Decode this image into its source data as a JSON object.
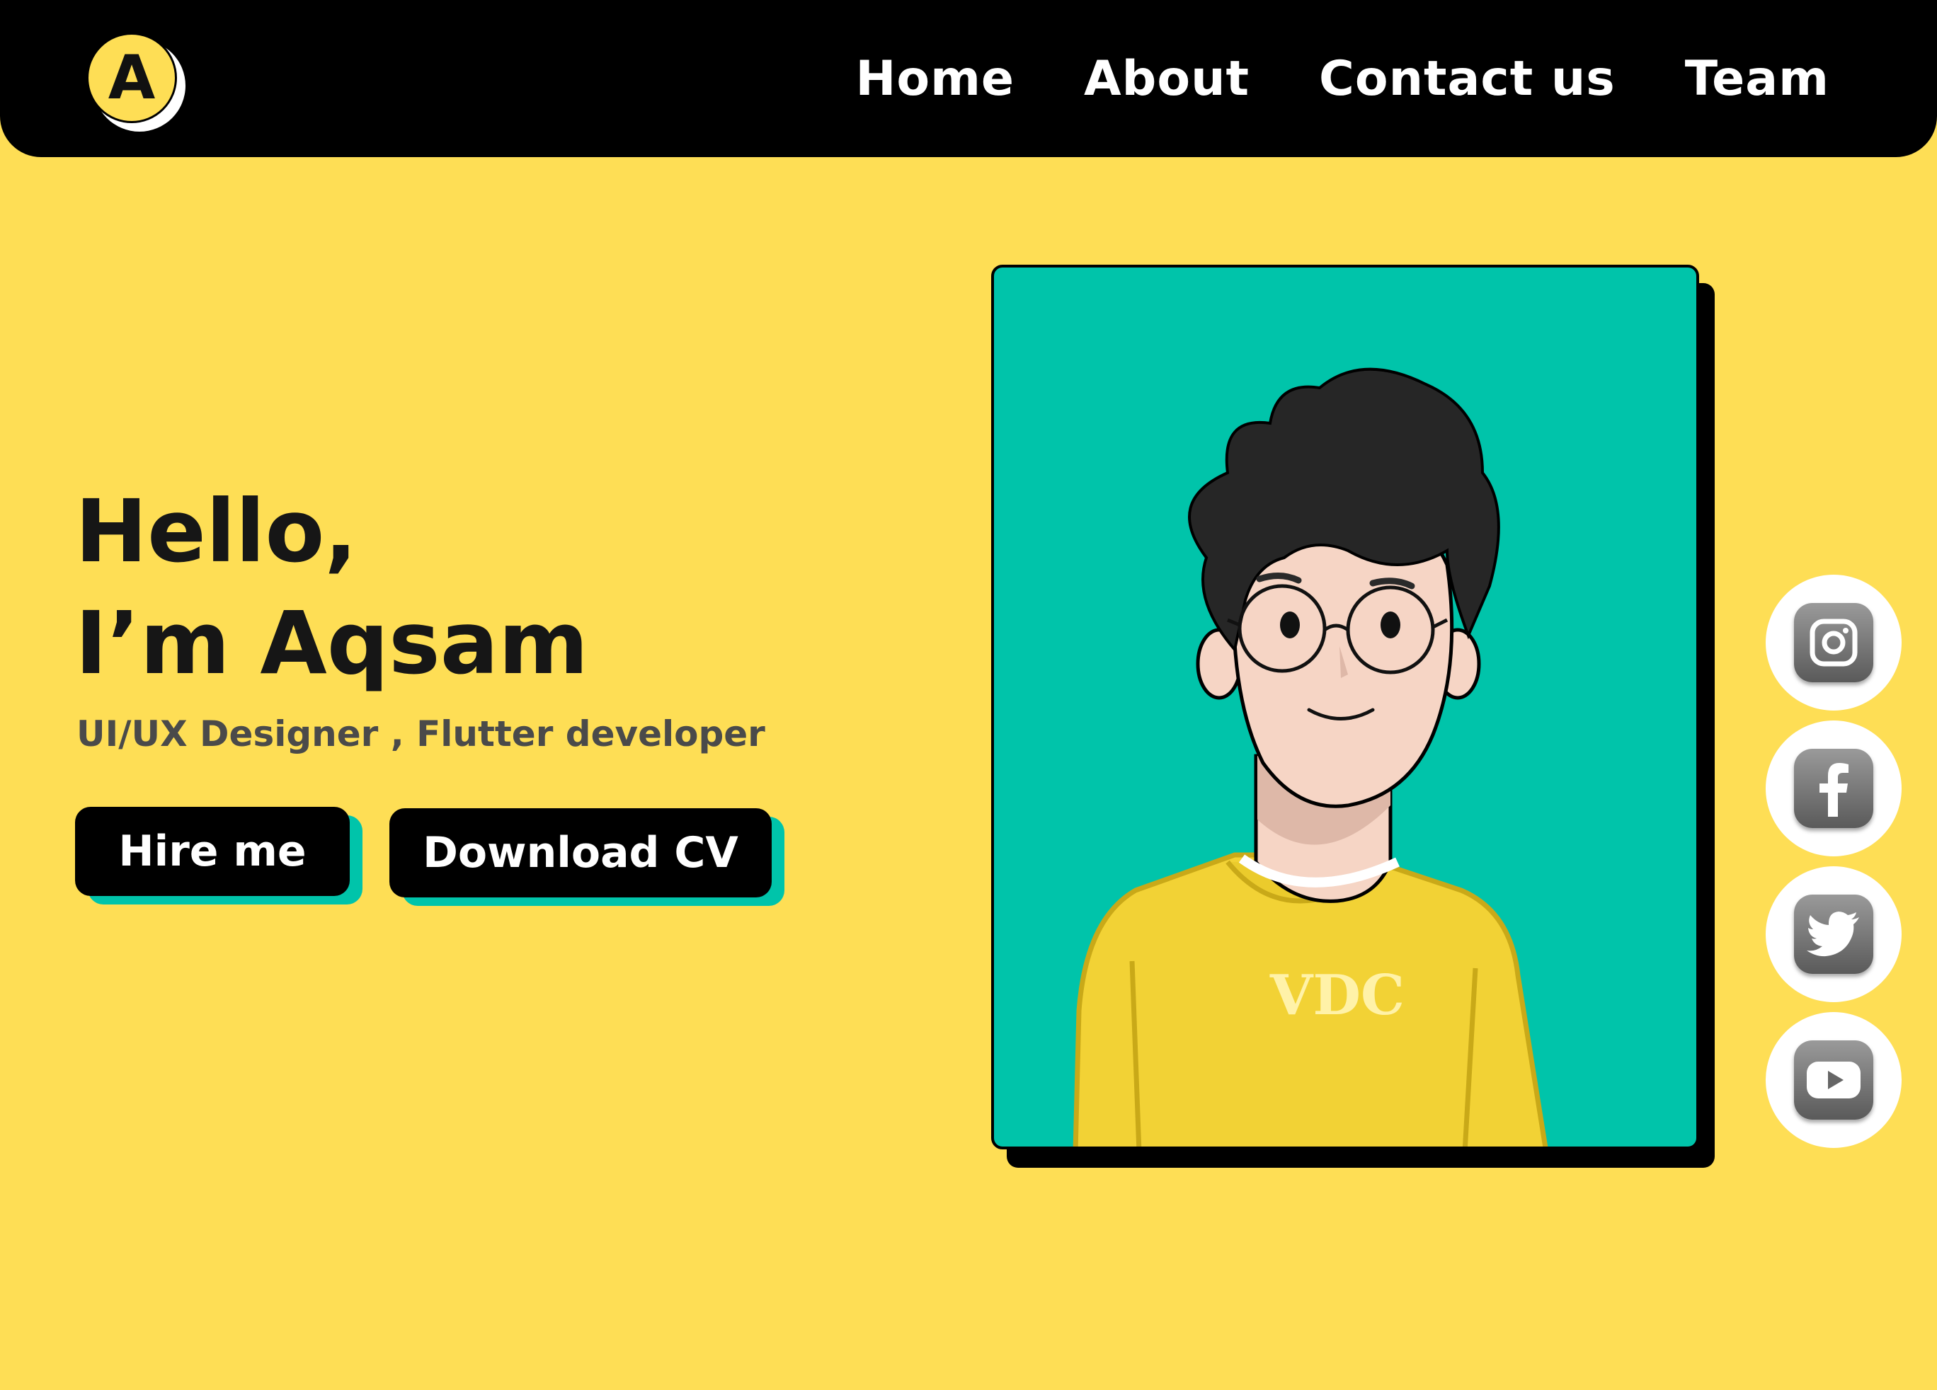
{
  "header": {
    "logo_letter": "A",
    "nav": [
      "Home",
      "About",
      "Contact us",
      "Team"
    ]
  },
  "hero": {
    "greeting": "Hello,",
    "name_line": "I’m Aqsam",
    "subtitle": "UI/UX Designer ,  Flutter developer",
    "hire_label": "Hire me",
    "cv_label": "Download CV"
  },
  "portrait": {
    "shirt_text": "VDC"
  },
  "social": [
    "instagram-icon",
    "facebook-icon",
    "twitter-icon",
    "youtube-icon"
  ],
  "colors": {
    "background": "#FEDE55",
    "accent": "#00C4AA",
    "dark": "#000000"
  }
}
